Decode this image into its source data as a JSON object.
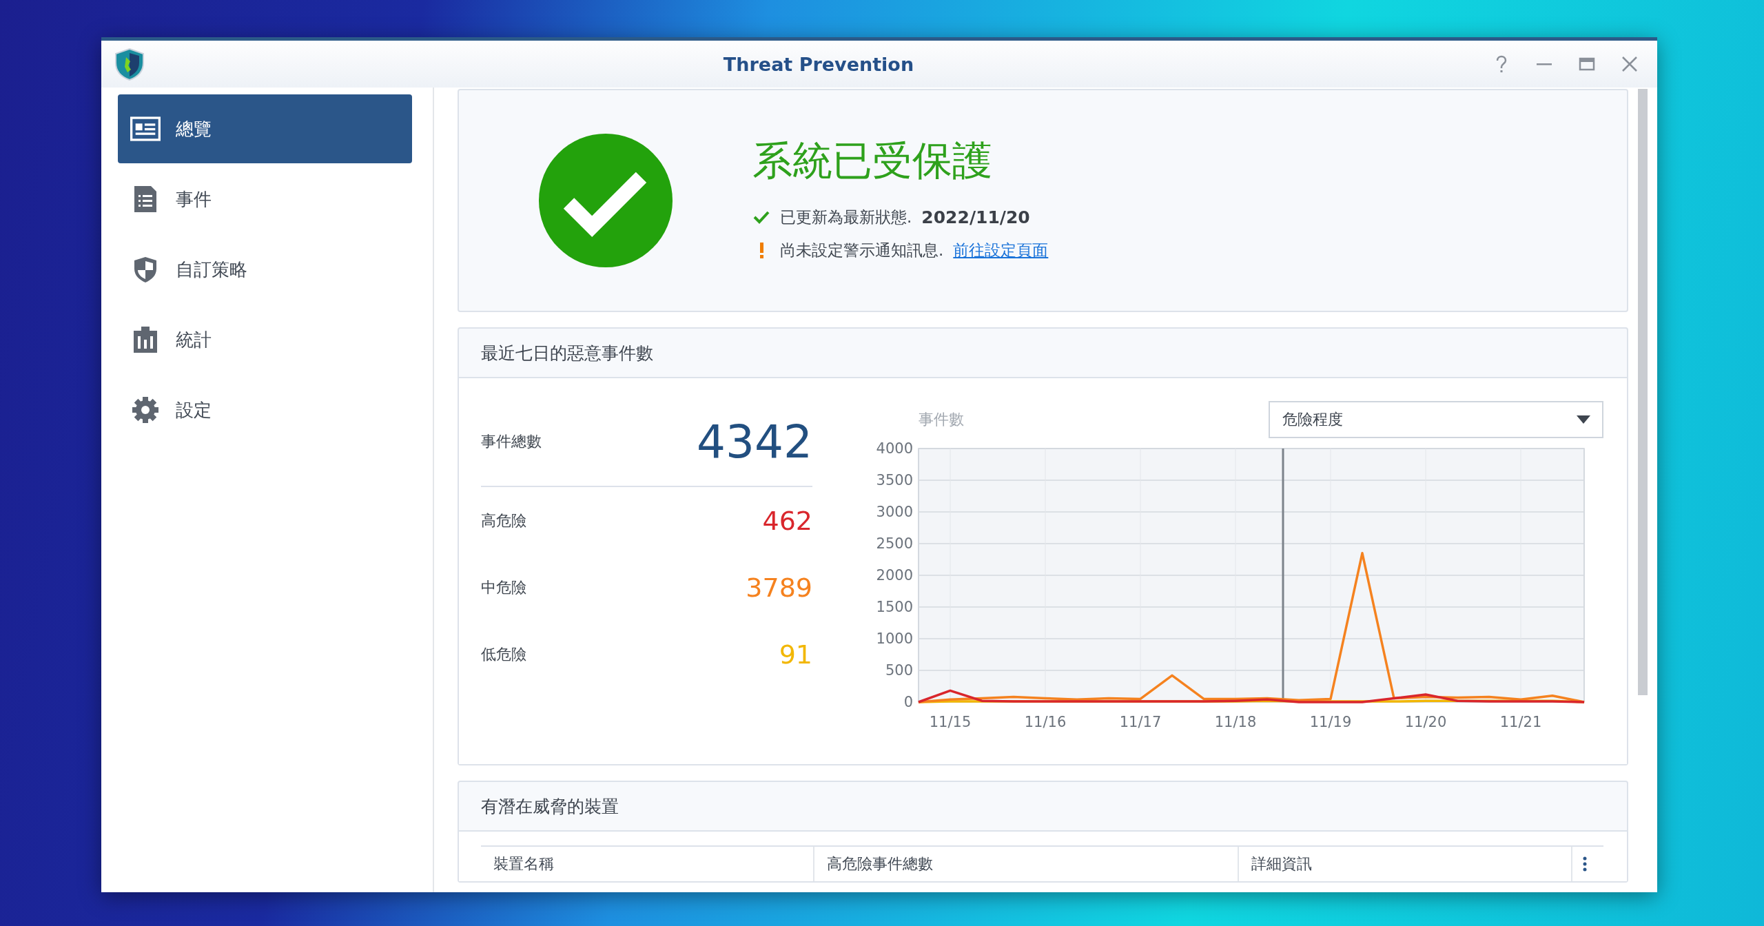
{
  "window": {
    "title": "Threat Prevention"
  },
  "sidebar": {
    "items": [
      {
        "label": "總覽",
        "selected": true
      },
      {
        "label": "事件",
        "selected": false
      },
      {
        "label": "自訂策略",
        "selected": false
      },
      {
        "label": "統計",
        "selected": false
      },
      {
        "label": "設定",
        "selected": false
      }
    ]
  },
  "status": {
    "title": "系統已受保護",
    "lines": [
      {
        "kind": "ok",
        "text": "已更新為最新狀態.",
        "value": "2022/11/20"
      },
      {
        "kind": "warning",
        "text": "尚未設定警示通知訊息.",
        "link": "前往設定頁面"
      }
    ]
  },
  "weekly": {
    "title": "最近七日的惡意事件數",
    "total_label": "事件總數",
    "total": "4342",
    "levels": [
      {
        "label": "高危險",
        "value": "462",
        "color": "#d9262c"
      },
      {
        "label": "中危險",
        "value": "3789",
        "color": "#f5821f"
      },
      {
        "label": "低危險",
        "value": "91",
        "color": "#f2b705"
      }
    ],
    "dropdown": "危險程度",
    "chart_data": {
      "type": "line",
      "ylabel": "事件數",
      "categories": [
        null,
        "11/15",
        null,
        null,
        "11/16",
        null,
        null,
        "11/17",
        null,
        null,
        "11/18",
        null,
        null,
        "11/19",
        null,
        null,
        "11/20",
        null,
        null,
        "11/21",
        null,
        null
      ],
      "series": [
        {
          "color": "#d9262c",
          "values": [
            0,
            180,
            20,
            10,
            10,
            10,
            10,
            10,
            10,
            10,
            20,
            40,
            0,
            0,
            0,
            60,
            120,
            20,
            10,
            10,
            10,
            0
          ]
        },
        {
          "color": "#f5821f",
          "values": [
            0,
            40,
            60,
            80,
            60,
            40,
            60,
            50,
            420,
            50,
            50,
            60,
            30,
            50,
            2350,
            60,
            80,
            70,
            80,
            40,
            100,
            0
          ]
        },
        {
          "color": "#f2b705",
          "values": [
            0,
            10,
            10,
            10,
            10,
            10,
            10,
            10,
            10,
            10,
            10,
            20,
            10,
            10,
            10,
            10,
            20,
            20,
            20,
            20,
            20,
            0
          ]
        }
      ],
      "ylim": [
        0,
        4000
      ],
      "grid": true,
      "yticks": [
        0,
        500,
        1000,
        1500,
        2000,
        2500,
        3000,
        3500,
        4000
      ]
    }
  },
  "devices": {
    "title": "有潛在威脅的裝置",
    "columns": [
      "裝置名稱",
      "高危險事件總數",
      "詳細資訊"
    ]
  }
}
